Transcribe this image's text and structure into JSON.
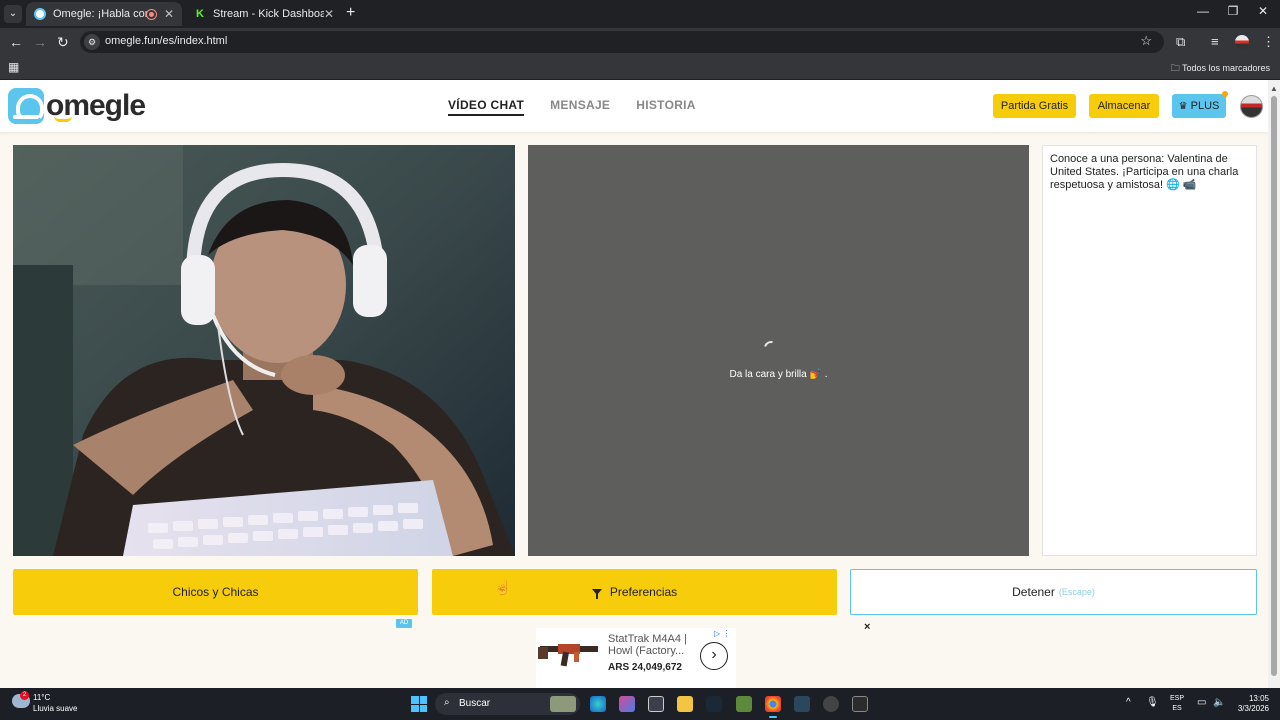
{
  "browser": {
    "tabs": [
      {
        "title": "Omegle: ¡Habla con Descor",
        "active": true
      },
      {
        "title": "Stream - Kick Dashboard",
        "active": false
      }
    ],
    "url": "omegle.fun/es/index.html",
    "bookmarks_all": "Todos los marcadores"
  },
  "site": {
    "logo_text": "omegle",
    "nav": [
      "VÍDEO CHAT",
      "MENSAJE",
      "HISTORIA"
    ],
    "buttons": {
      "free_match": "Partida Gratis",
      "store": "Almacenar",
      "plus": "PLUS"
    }
  },
  "video": {
    "remote_status": "Da la cara y brilla 💅 ."
  },
  "chat": {
    "message": "Conoce a una persona: Valentina de United States. ¡Participa en una charla respetuosa y amistosa! 🌐 📹"
  },
  "actions": {
    "gender": "Chicos y Chicas",
    "preferences": "Preferencias",
    "stop": "Detener",
    "stop_hint": "(Escape)"
  },
  "ad": {
    "badge": "AD",
    "title": "StatTrak M4A4 | Howl (Factory...",
    "price": "ARS 24,049,672",
    "close": "×"
  },
  "taskbar": {
    "weather_badge": "2",
    "temperature": "11°C",
    "weather_desc": "Lluvia suave",
    "search_label": "Buscar",
    "lang_top": "ESP",
    "lang_bottom": "ES",
    "time": "13:05",
    "date": "3/3/2026"
  },
  "colors": {
    "accent_yellow": "#f7cd0b",
    "accent_blue": "#5bc5ee",
    "page_bg": "#fbf7f1",
    "remote_bg": "#5e5f5c"
  }
}
